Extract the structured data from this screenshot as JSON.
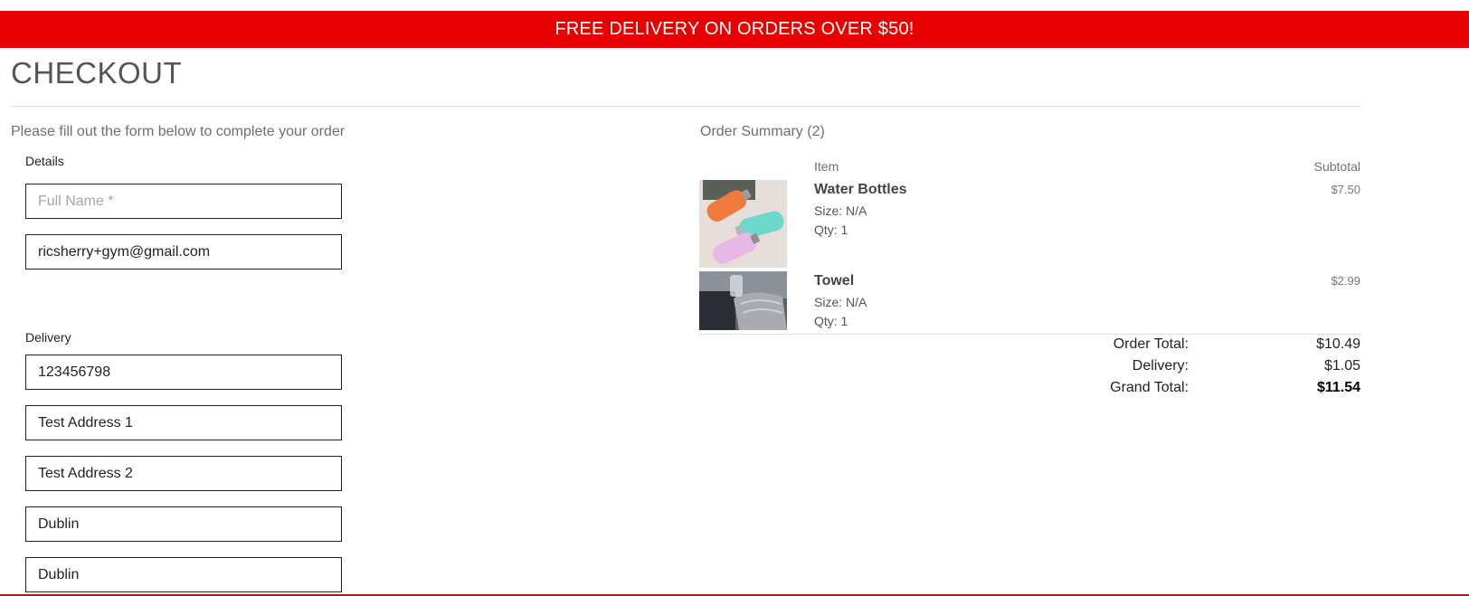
{
  "banner": {
    "text": "FREE DELIVERY ON ORDERS OVER $50!"
  },
  "page": {
    "title": "CHECKOUT",
    "instructions": "Please fill out the form below to complete your order"
  },
  "form": {
    "details_label": "Details",
    "full_name": {
      "value": "",
      "placeholder": "Full Name *"
    },
    "email": {
      "value": "ricsherry+gym@gmail.com"
    },
    "delivery_label": "Delivery",
    "phone": {
      "value": "123456798"
    },
    "address1": {
      "value": "Test Address 1"
    },
    "address2": {
      "value": "Test Address 2"
    },
    "town": {
      "value": "Dublin"
    },
    "county": {
      "value": "Dublin"
    }
  },
  "summary": {
    "title": "Order Summary (2)",
    "col_item": "Item",
    "col_subtotal": "Subtotal",
    "items": [
      {
        "name": "Water Bottles",
        "size": "Size: N/A",
        "qty": "Qty: 1",
        "price": "$7.50",
        "image": "water-bottles-photo"
      },
      {
        "name": "Towel",
        "size": "Size: N/A",
        "qty": "Qty: 1",
        "price": "$2.99",
        "image": "towel-photo"
      }
    ],
    "order_total_label": "Order Total:",
    "order_total": "$10.49",
    "delivery_label": "Delivery:",
    "delivery": "$1.05",
    "grand_total_label": "Grand Total:",
    "grand_total": "$11.54"
  },
  "colors": {
    "brand_red": "#e60000",
    "text_muted": "#6f6f6f"
  }
}
